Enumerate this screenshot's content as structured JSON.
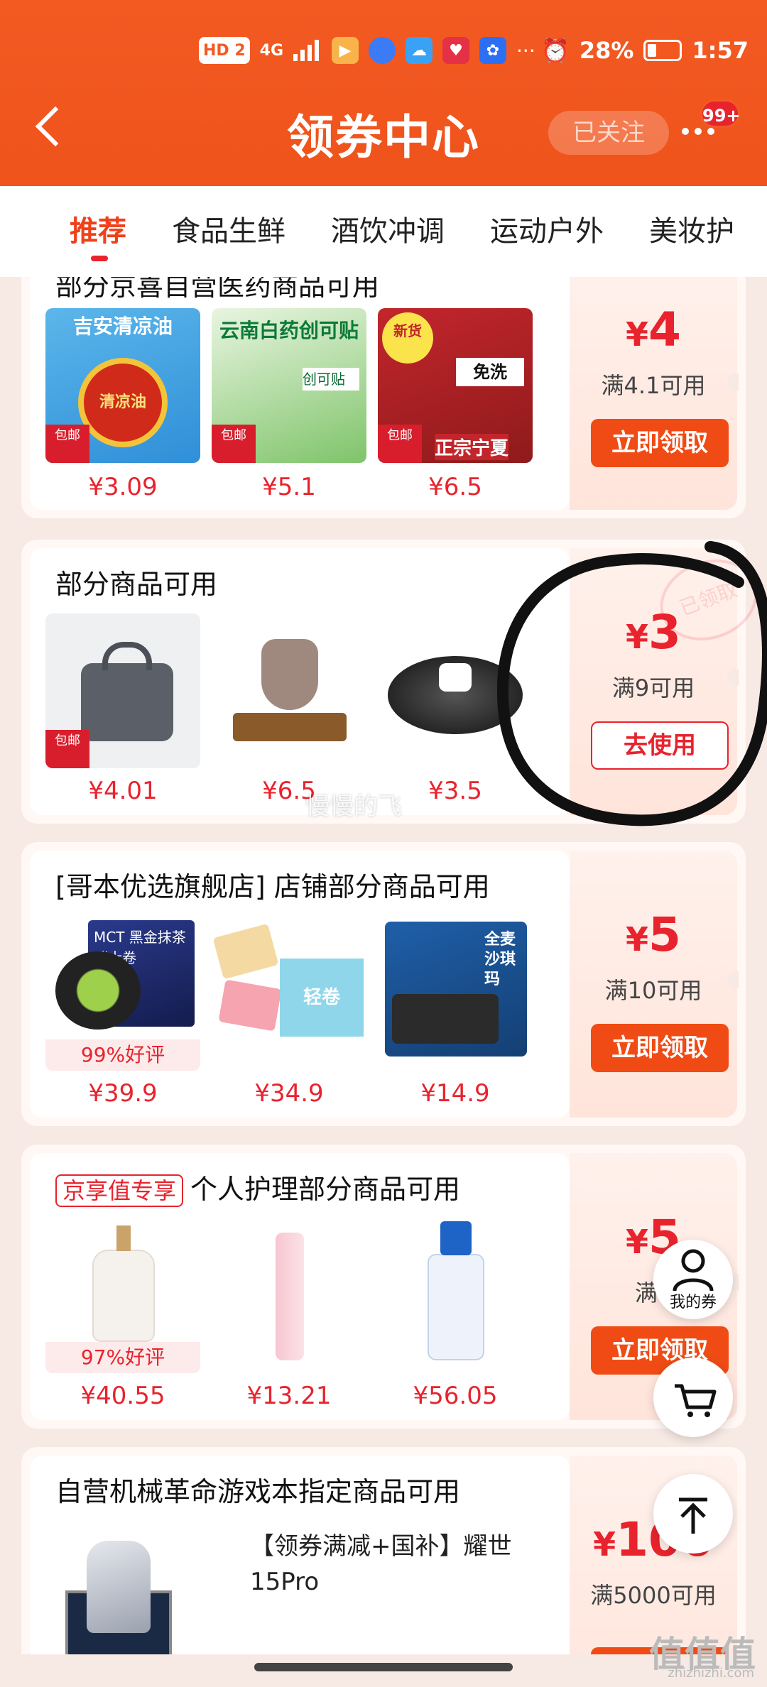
{
  "status": {
    "chips": [
      "HD 2",
      "4G"
    ],
    "battery": "28%",
    "time": "1:57"
  },
  "header": {
    "title": "领券中心",
    "follow_label": "已关注",
    "badge": "99+"
  },
  "tabs": [
    "推荐",
    "食品生鲜",
    "酒饮冲调",
    "运动户外",
    "美妆护"
  ],
  "cards": [
    {
      "title": "部分京喜自营医药商品可用",
      "products": [
        {
          "name": "吉安清凉油",
          "label": "清凉油",
          "price": "¥3.09",
          "mark": "包邮"
        },
        {
          "name": "云南白药创可贴",
          "label": "创可贴",
          "price": "¥5.1",
          "mark": "包邮"
        },
        {
          "name": "正宗宁夏",
          "label": "免洗",
          "price": "¥6.5",
          "mark": "包邮"
        }
      ],
      "amount_symbol": "¥",
      "amount": "4",
      "condition": "满4.1可用",
      "button": "立即领取"
    },
    {
      "title": "部分商品可用",
      "products": [
        {
          "name": "lunch-bag",
          "price": "¥4.01",
          "mark": "包邮"
        },
        {
          "name": "tea-set",
          "price": "¥6.5"
        },
        {
          "name": "pot-lid",
          "price": "¥3.5"
        }
      ],
      "amount_symbol": "¥",
      "amount": "3",
      "condition": "满9可用",
      "button": "去使用",
      "stamp": "已领取"
    },
    {
      "title": "[哥本优选旗舰店] 店铺部分商品可用",
      "products": [
        {
          "name": "MCT 黑金抹茶瑞士卷",
          "rating": "99%好评",
          "price": "¥39.9"
        },
        {
          "name": "轻卷",
          "price": "¥34.9"
        },
        {
          "name": "全麦沙琪玛",
          "price": "¥14.9"
        }
      ],
      "amount_symbol": "¥",
      "amount": "5",
      "condition": "满10可用",
      "button": "立即领取"
    },
    {
      "tag": "京享值专享",
      "title": "个人护理部分商品可用",
      "products": [
        {
          "name": "lotion",
          "rating": "97%好评",
          "price": "¥40.55"
        },
        {
          "name": "toothbrush",
          "price": "¥13.21"
        },
        {
          "name": "cerave",
          "price": "¥56.05"
        }
      ],
      "amount_symbol": "¥",
      "amount": "5",
      "condition": "满6",
      "button": "立即领取"
    },
    {
      "title": "自营机械革命游戏本指定商品可用",
      "product_desc_line1": "【领券满减+国补】耀世",
      "product_desc_line2": "15Pro",
      "amount_symbol": "¥",
      "amount": "100",
      "condition": "满5000可用"
    }
  ],
  "float": {
    "my_coupons": "我的券"
  },
  "watermark": "慢慢的飞",
  "site": {
    "mark": "值值值",
    "url": "zhizhizhi.com"
  },
  "colors": {
    "brand": "#f25a22",
    "price_red": "#e8232d",
    "button": "#f04b14"
  }
}
